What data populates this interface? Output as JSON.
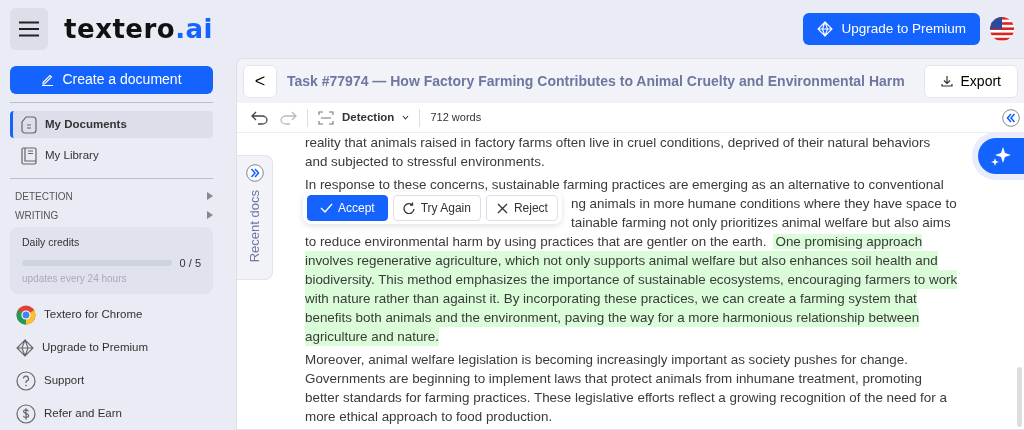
{
  "header": {
    "logo": {
      "main": "textero",
      "accent": ".ai"
    },
    "upgrade_button": "Upgrade to Premium"
  },
  "sidebar": {
    "create_button": "Create a document",
    "nav": [
      {
        "label": "My Documents",
        "selected": true
      },
      {
        "label": "My Library",
        "selected": false
      }
    ],
    "sections": [
      {
        "label": "DETECTION"
      },
      {
        "label": "WRITING"
      }
    ],
    "credits": {
      "title": "Daily credits",
      "level": 0,
      "reading": "0 / 5",
      "note": "updates every 24 hours"
    },
    "links": [
      {
        "label": "Textero for Chrome"
      },
      {
        "label": "Upgrade to Premium"
      },
      {
        "label": "Support"
      },
      {
        "label": "Refer and Earn"
      }
    ]
  },
  "document": {
    "back": "<",
    "title": "Task #77974 — How Factory Farming Contributes to Animal Cruelty and Environmental Harm",
    "export_button": "Export",
    "toolbar": {
      "undo_enabled": true,
      "redo_enabled": false,
      "mode": "Detection",
      "word_count": "712 words"
    },
    "recent_docs": "Recent docs",
    "paragraphs": [
      {
        "lines": [
          {
            "segments": [
              {
                "text": "reality that animals raised in factory farms often live in cruel conditions, deprived of their natural behaviors",
                "highlighted": false
              }
            ]
          },
          {
            "segments": [
              {
                "text": "and subjected to stressful environments.",
                "highlighted": false
              }
            ]
          }
        ]
      },
      {
        "lines": [
          {
            "segments": [
              {
                "text": "In response to these concerns, sustainable farming practices are emerging as an alternative to conventional",
                "highlighted": false
              }
            ]
          },
          {
            "covered": true,
            "segments": [
              {
                "text": "ng animals in more humane conditions where they have space to",
                "highlighted": false
              }
            ]
          },
          {
            "covered": true,
            "segments": [
              {
                "text": "tainable farming not only prioritizes animal welfare but also aims",
                "highlighted": false
              }
            ]
          },
          {
            "segments": [
              {
                "text": "to reduce environmental harm by using practices that are gentler on the earth.",
                "highlighted": false
              },
              {
                "text": "One promising approach",
                "highlighted": true
              }
            ]
          },
          {
            "segments": [
              {
                "text": "involves regenerative agriculture, which not only supports animal welfare but also enhances soil health and",
                "highlighted": true
              }
            ]
          },
          {
            "segments": [
              {
                "text": "biodiversity. This method emphasizes the importance of sustainable ecosystems, encouraging farmers to work",
                "highlighted": true
              }
            ]
          },
          {
            "segments": [
              {
                "text": "with nature rather than against it. By incorporating these practices, we can create a farming system that",
                "highlighted": true
              }
            ]
          },
          {
            "segments": [
              {
                "text": "benefits both animals and the environment, paving the way for a more harmonious relationship between",
                "highlighted": true
              }
            ]
          },
          {
            "segments": [
              {
                "text": "agriculture and nature.",
                "highlighted": true
              }
            ]
          }
        ]
      },
      {
        "lines": [
          {
            "segments": [
              {
                "text": "Moreover, animal welfare legislation is becoming increasingly important as society pushes for change.",
                "highlighted": false
              }
            ]
          },
          {
            "segments": [
              {
                "text": "Governments are beginning to implement laws that protect animals from inhumane treatment, promoting",
                "highlighted": false
              }
            ]
          },
          {
            "segments": [
              {
                "text": "better standards for farming practices. These legislative efforts reflect a growing recognition of the need for a",
                "highlighted": false
              }
            ]
          },
          {
            "segments": [
              {
                "text": "more ethical approach to food production.",
                "highlighted": false
              }
            ]
          }
        ]
      }
    ],
    "suggestion_popup": {
      "buttons": [
        {
          "label": "Accept",
          "kind": "accept"
        },
        {
          "label": "Try Again",
          "kind": "retry"
        },
        {
          "label": "Reject",
          "kind": "reject"
        }
      ]
    }
  }
}
